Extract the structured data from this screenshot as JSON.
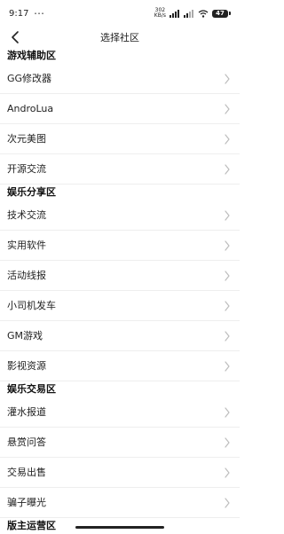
{
  "status_bar": {
    "time": "9:17",
    "dots": "···",
    "net_speed_value": "302",
    "net_speed_unit": "KB/s",
    "battery": "47"
  },
  "nav": {
    "title": "选择社区"
  },
  "sections": [
    {
      "header": "游戏辅助区",
      "items": [
        "GG修改器",
        "AndroLua",
        "次元美图",
        "开源交流"
      ]
    },
    {
      "header": "娱乐分享区",
      "items": [
        "技术交流",
        "实用软件",
        "活动线报",
        "小司机发车",
        "GM游戏",
        "影视资源"
      ]
    },
    {
      "header": "娱乐交易区",
      "items": [
        "灌水报道",
        "悬赏问答",
        "交易出售",
        "骗子曝光"
      ]
    },
    {
      "header": "版主运营区",
      "items": []
    }
  ]
}
